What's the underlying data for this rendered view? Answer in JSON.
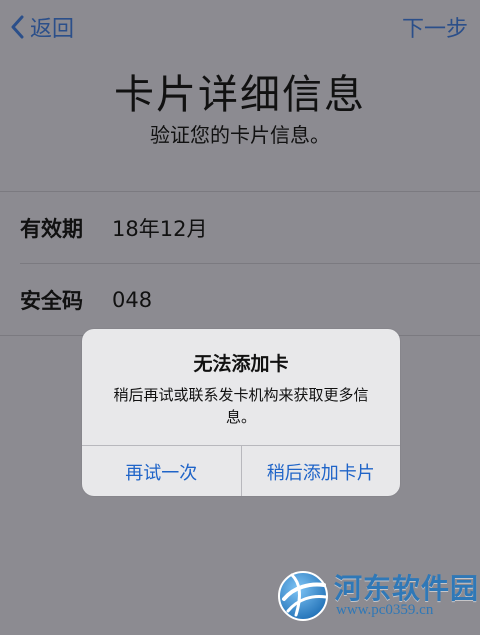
{
  "nav": {
    "back_label": "返回",
    "next_label": "下一步"
  },
  "page": {
    "title": "卡片详细信息",
    "subtitle": "验证您的卡片信息。"
  },
  "form": {
    "rows": [
      {
        "label": "有效期",
        "value": "18年12月"
      },
      {
        "label": "安全码",
        "value": "048"
      }
    ]
  },
  "alert": {
    "title": "无法添加卡",
    "message": "稍后再试或联系发卡机构来获取更多信息。",
    "buttons": [
      {
        "label": "再试一次"
      },
      {
        "label": "稍后添加卡片"
      }
    ]
  },
  "watermark": {
    "name": "河东软件园",
    "url": "www.pc0359.cn"
  },
  "colors": {
    "nav_accent": "#2b4f8a",
    "alert_button": "#1f64c8",
    "watermark": "#2f78b7",
    "dimmed_background": "#8c8b91",
    "alert_background": "#e8e8ea"
  },
  "icons": {
    "back": "chevron-left-icon",
    "watermark_logo": "globe-logo-icon"
  }
}
